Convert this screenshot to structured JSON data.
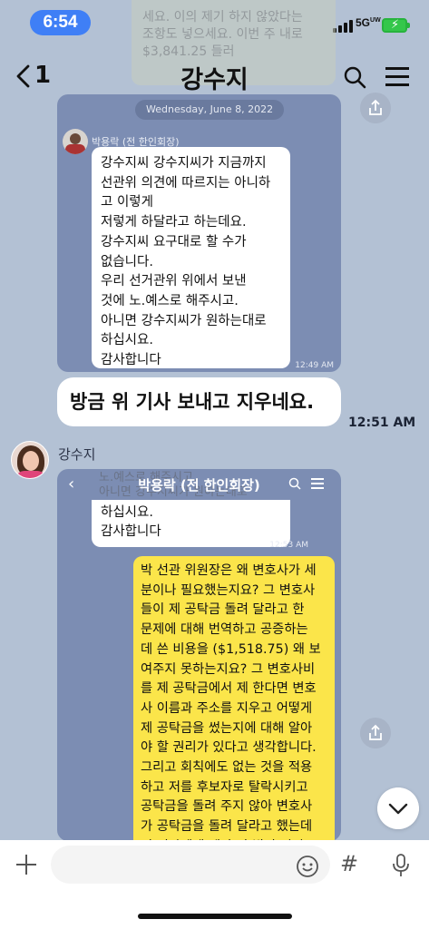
{
  "status_bar": {
    "time": "6:54",
    "network": "5G",
    "network_sub": "UW",
    "battery_color": "#34c74a",
    "time_pill_color": "#3f7ff6"
  },
  "header": {
    "back_count": "1",
    "title": "강수지"
  },
  "faded_top_text": "세요. 이의 제기 하지 않았다는\n조항도 넣으세요. 이번 주 내로\n$3,841.25 들러",
  "screenshot1": {
    "date": "Wednesday, June 8, 2022",
    "sender": "박용락 (전 한인회장)",
    "message": "강수지씨  강수지씨가 지금까지\n선관위 의견에 따르지는 아니하\n고  이렇게\n저렇게 하달라고 하는데요.\n강수지씨 요구대로 할 수가\n없습니다.\n우리 선거관위 위에서 보낸\n것에 노.예스로 해주시고.\n아니면 강수지씨가 원하는대로\n하십시요.\n감사합니다",
    "time": "12:49 AM"
  },
  "text_message": {
    "text": "방금 위 기사 보내고 지우네요.",
    "time": "12:51 AM"
  },
  "sender": {
    "name": "강수지"
  },
  "screenshot2": {
    "header_title": "박용락 (전 한인회장)",
    "ghost_text": "노.예스로 해주시고.\n아니면 강수지씨가 원하는대로",
    "message": "하십시요.\n감사합니다",
    "time": "12:53 AM",
    "reply": "박 선관 위원장은 왜 변호사가 세\n분이나 필요했는지요? 그 변호사\n들이 제 공탁금 돌려 달라고 한\n문제에 대해 번역하고 공증하는\n데 쓴 비용을 ($1,518.75) 왜 보\n여주지 못하는지요? 그 변호사비\n를 제 공탁금에서 제 한다면 변호\n사 이름과 주소를 지우고 어떻게\n제 공탁금을 썼는지에 대해 알아\n야 할 권리가 있다고 생각합니다.\n그리고 회칙에도 없는 것을 적용\n하고 저를 후보자로 탈락시키고\n공탁금을 돌려 주지 않아 변호사\n가 공탁금을 돌려 달라고 했는데\n전 기자에게 제가 안 받아 갔다고"
  },
  "input": {
    "value": "",
    "placeholder": ""
  }
}
